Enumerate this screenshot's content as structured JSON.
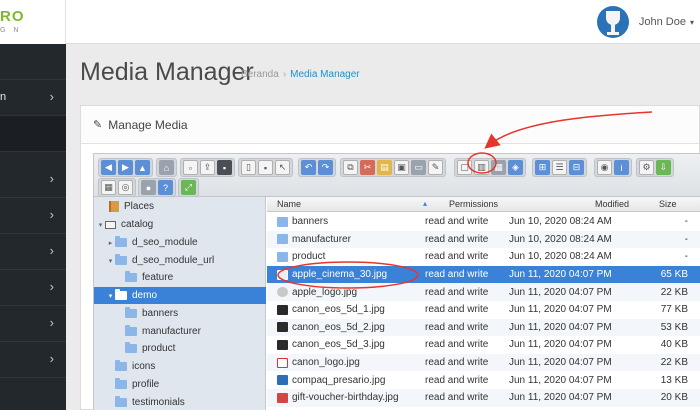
{
  "logo": {
    "line1": "RO",
    "line2": "G N"
  },
  "user": {
    "name": "John Doe",
    "caret": "▾"
  },
  "sidebar": {
    "items": [
      {
        "label": "",
        "chevron": ""
      },
      {
        "label": "n",
        "chevron": "›"
      },
      {
        "label": "",
        "chevron": ""
      },
      {
        "label": "",
        "chevron": "›"
      },
      {
        "label": "",
        "chevron": "›"
      },
      {
        "label": "",
        "chevron": "›"
      },
      {
        "label": "",
        "chevron": "›"
      },
      {
        "label": "",
        "chevron": "›"
      },
      {
        "label": "",
        "chevron": "›"
      }
    ]
  },
  "page": {
    "title": "Media Manager",
    "breadcrumb": {
      "home": "Beranda",
      "separator": "›",
      "current": "Media Manager"
    }
  },
  "panel": {
    "title": "Manage Media"
  },
  "places": {
    "items": [
      {
        "label": "Places",
        "icon": "book-icon",
        "indent": 0,
        "toggle": ""
      },
      {
        "label": "catalog",
        "icon": "drive-icon",
        "indent": 0,
        "toggle": "▾"
      },
      {
        "label": "d_seo_module",
        "icon": "folder-icon",
        "indent": 1,
        "toggle": "▸"
      },
      {
        "label": "d_seo_module_url",
        "icon": "folder-icon",
        "indent": 1,
        "toggle": "▾"
      },
      {
        "label": "feature",
        "icon": "folder-icon",
        "indent": 2,
        "toggle": ""
      },
      {
        "label": "demo",
        "icon": "folder-icon",
        "indent": 1,
        "toggle": "▾",
        "selected": true
      },
      {
        "label": "banners",
        "icon": "folder-icon",
        "indent": 2,
        "toggle": ""
      },
      {
        "label": "manufacturer",
        "icon": "folder-icon",
        "indent": 2,
        "toggle": ""
      },
      {
        "label": "product",
        "icon": "folder-icon",
        "indent": 2,
        "toggle": ""
      },
      {
        "label": "icons",
        "icon": "folder-icon",
        "indent": 1,
        "toggle": ""
      },
      {
        "label": "profile",
        "icon": "folder-icon",
        "indent": 1,
        "toggle": ""
      },
      {
        "label": "testimonials",
        "icon": "folder-icon",
        "indent": 1,
        "toggle": ""
      }
    ]
  },
  "files": {
    "columns": {
      "name": "Name",
      "sort_indicator": "▴",
      "permissions": "Permissions",
      "modified": "Modified",
      "size": "Size"
    },
    "rows": [
      {
        "name": "banners",
        "permissions": "read and write",
        "modified": "Jun 10, 2020 08:24 AM",
        "size": "-",
        "icon": "folder-icon"
      },
      {
        "name": "manufacturer",
        "permissions": "read and write",
        "modified": "Jun 10, 2020 08:24 AM",
        "size": "-",
        "icon": "folder-icon"
      },
      {
        "name": "product",
        "permissions": "read and write",
        "modified": "Jun 10, 2020 08:24 AM",
        "size": "-",
        "icon": "folder-icon"
      },
      {
        "name": "apple_cinema_30.jpg",
        "permissions": "read and write",
        "modified": "Jun 11, 2020 04:07 PM",
        "size": "65 KB",
        "icon": "image-icon",
        "selected": true
      },
      {
        "name": "apple_logo.jpg",
        "permissions": "read and write",
        "modified": "Jun 11, 2020 04:07 PM",
        "size": "22 KB",
        "icon": "apple-icon"
      },
      {
        "name": "canon_eos_5d_1.jpg",
        "permissions": "read and write",
        "modified": "Jun 11, 2020 04:07 PM",
        "size": "77 KB",
        "icon": "camera-icon"
      },
      {
        "name": "canon_eos_5d_2.jpg",
        "permissions": "read and write",
        "modified": "Jun 11, 2020 04:07 PM",
        "size": "53 KB",
        "icon": "camera-icon"
      },
      {
        "name": "canon_eos_5d_3.jpg",
        "permissions": "read and write",
        "modified": "Jun 11, 2020 04:07 PM",
        "size": "40 KB",
        "icon": "camera-icon"
      },
      {
        "name": "canon_logo.jpg",
        "permissions": "read and write",
        "modified": "Jun 11, 2020 04:07 PM",
        "size": "22 KB",
        "icon": "logo-icon"
      },
      {
        "name": "compaq_presario.jpg",
        "permissions": "read and write",
        "modified": "Jun 11, 2020 04:07 PM",
        "size": "13 KB",
        "icon": "monitor-icon"
      },
      {
        "name": "gift-voucher-birthday.jpg",
        "permissions": "read and write",
        "modified": "Jun 11, 2020 04:07 PM",
        "size": "20 KB",
        "icon": "gift-icon"
      }
    ]
  },
  "colors": {
    "accent": "#3a82d8",
    "annotation": "#e8352b",
    "sidebar_bg": "#23282d",
    "logo": "#7fb82f"
  }
}
